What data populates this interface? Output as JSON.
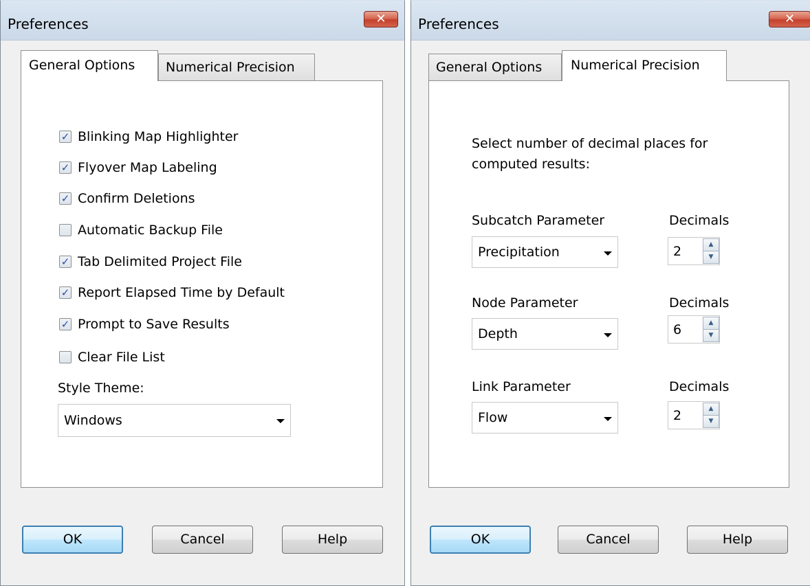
{
  "left": {
    "title": "Preferences",
    "close_glyph": "✕",
    "tabs": [
      "General Options",
      "Numerical Precision"
    ],
    "checkboxes": [
      {
        "label": "Blinking Map Highlighter",
        "checked": true
      },
      {
        "label": "Flyover Map Labeling",
        "checked": true
      },
      {
        "label": "Confirm Deletions",
        "checked": true
      },
      {
        "label": "Automatic Backup File",
        "checked": false
      },
      {
        "label": "Tab Delimited Project File",
        "checked": true
      },
      {
        "label": "Report Elapsed Time by Default",
        "checked": true
      },
      {
        "label": "Prompt to Save Results",
        "checked": true
      },
      {
        "label": "Clear File List",
        "checked": false
      }
    ],
    "style_theme_label": "Style Theme:",
    "style_theme_value": "Windows",
    "buttons": {
      "ok": "OK",
      "cancel": "Cancel",
      "help": "Help"
    }
  },
  "right": {
    "title": "Preferences",
    "close_glyph": "✕",
    "tabs": [
      "General Options",
      "Numerical Precision"
    ],
    "instruction_line1": "Select number of decimal places for",
    "instruction_line2": "computed results:",
    "params": [
      {
        "label": "Subcatch Parameter",
        "value": "Precipitation",
        "decimals_label": "Decimals",
        "decimals": "2"
      },
      {
        "label": "Node Parameter",
        "value": "Depth",
        "decimals_label": "Decimals",
        "decimals": "6"
      },
      {
        "label": "Link Parameter",
        "value": "Flow",
        "decimals_label": "Decimals",
        "decimals": "2"
      }
    ],
    "buttons": {
      "ok": "OK",
      "cancel": "Cancel",
      "help": "Help"
    }
  },
  "check_glyph": "✓",
  "spin_up_glyph": "▲",
  "spin_down_glyph": "▼"
}
